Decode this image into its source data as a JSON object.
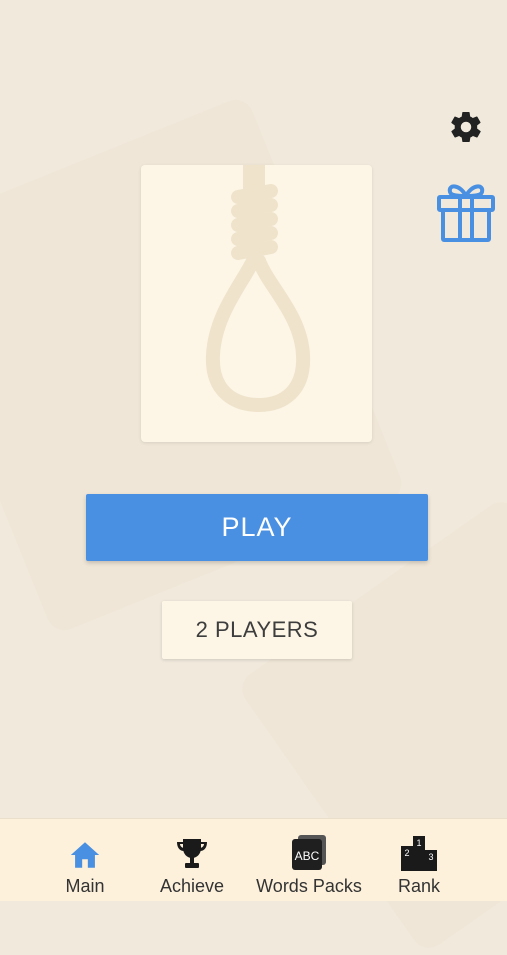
{
  "header": {
    "settings_icon": "gear-icon",
    "gift_icon": "gift-icon"
  },
  "card": {
    "icon": "noose-icon"
  },
  "buttons": {
    "play_label": "PLAY",
    "two_players_label": "2 PLAYERS"
  },
  "nav": {
    "items": [
      {
        "label": "Main",
        "icon": "home-icon",
        "active": true
      },
      {
        "label": "Achieve",
        "icon": "trophy-icon"
      },
      {
        "label": "Words Packs",
        "icon": "abc-cards-icon",
        "icon_text": "ABC"
      },
      {
        "label": "Rank",
        "icon": "podium-icon",
        "podium_numbers": [
          "2",
          "1",
          "3"
        ]
      }
    ]
  },
  "colors": {
    "background": "#f1e9dc",
    "accent_blue": "#4a90e2",
    "card": "#fdf6e6",
    "nav_bg": "#fdf1dc"
  }
}
